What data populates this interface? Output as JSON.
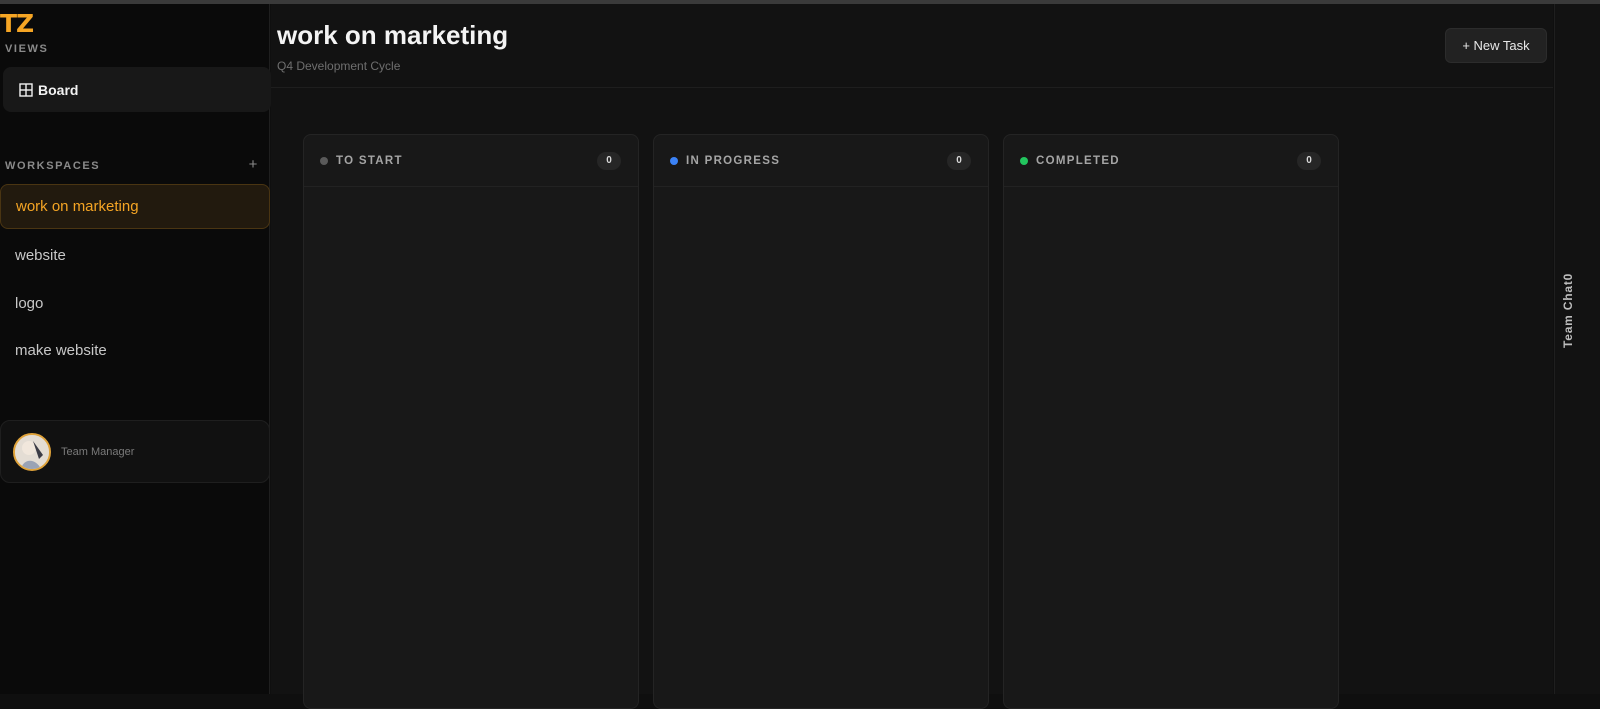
{
  "sidebar": {
    "logo_text": "TZ",
    "views_label": "VIEWS",
    "views": [
      {
        "label": "Board",
        "icon": "grid-icon"
      }
    ],
    "workspaces_label": "WORKSPACES",
    "add_workspace": "+",
    "workspaces": [
      {
        "label": "work on marketing",
        "active": true
      },
      {
        "label": "website",
        "active": false
      },
      {
        "label": "logo",
        "active": false
      },
      {
        "label": "make website",
        "active": false
      }
    ],
    "user": {
      "role": "Team Manager"
    }
  },
  "header": {
    "title": "work on marketing",
    "subtitle": "Q4 Development Cycle",
    "new_task_label": "+ New Task"
  },
  "columns": [
    {
      "title": "TO START",
      "count": "0",
      "dot_color": "#5a5a5a"
    },
    {
      "title": "IN PROGRESS",
      "count": "0",
      "dot_color": "#3b82f6"
    },
    {
      "title": "COMPLETED",
      "count": "0",
      "dot_color": "#22c55e"
    }
  ],
  "right_rail": {
    "label": "Team Chat0"
  },
  "colors": {
    "accent": "#f5a524",
    "background": "#121212",
    "sidebar": "#0a0a0a"
  }
}
